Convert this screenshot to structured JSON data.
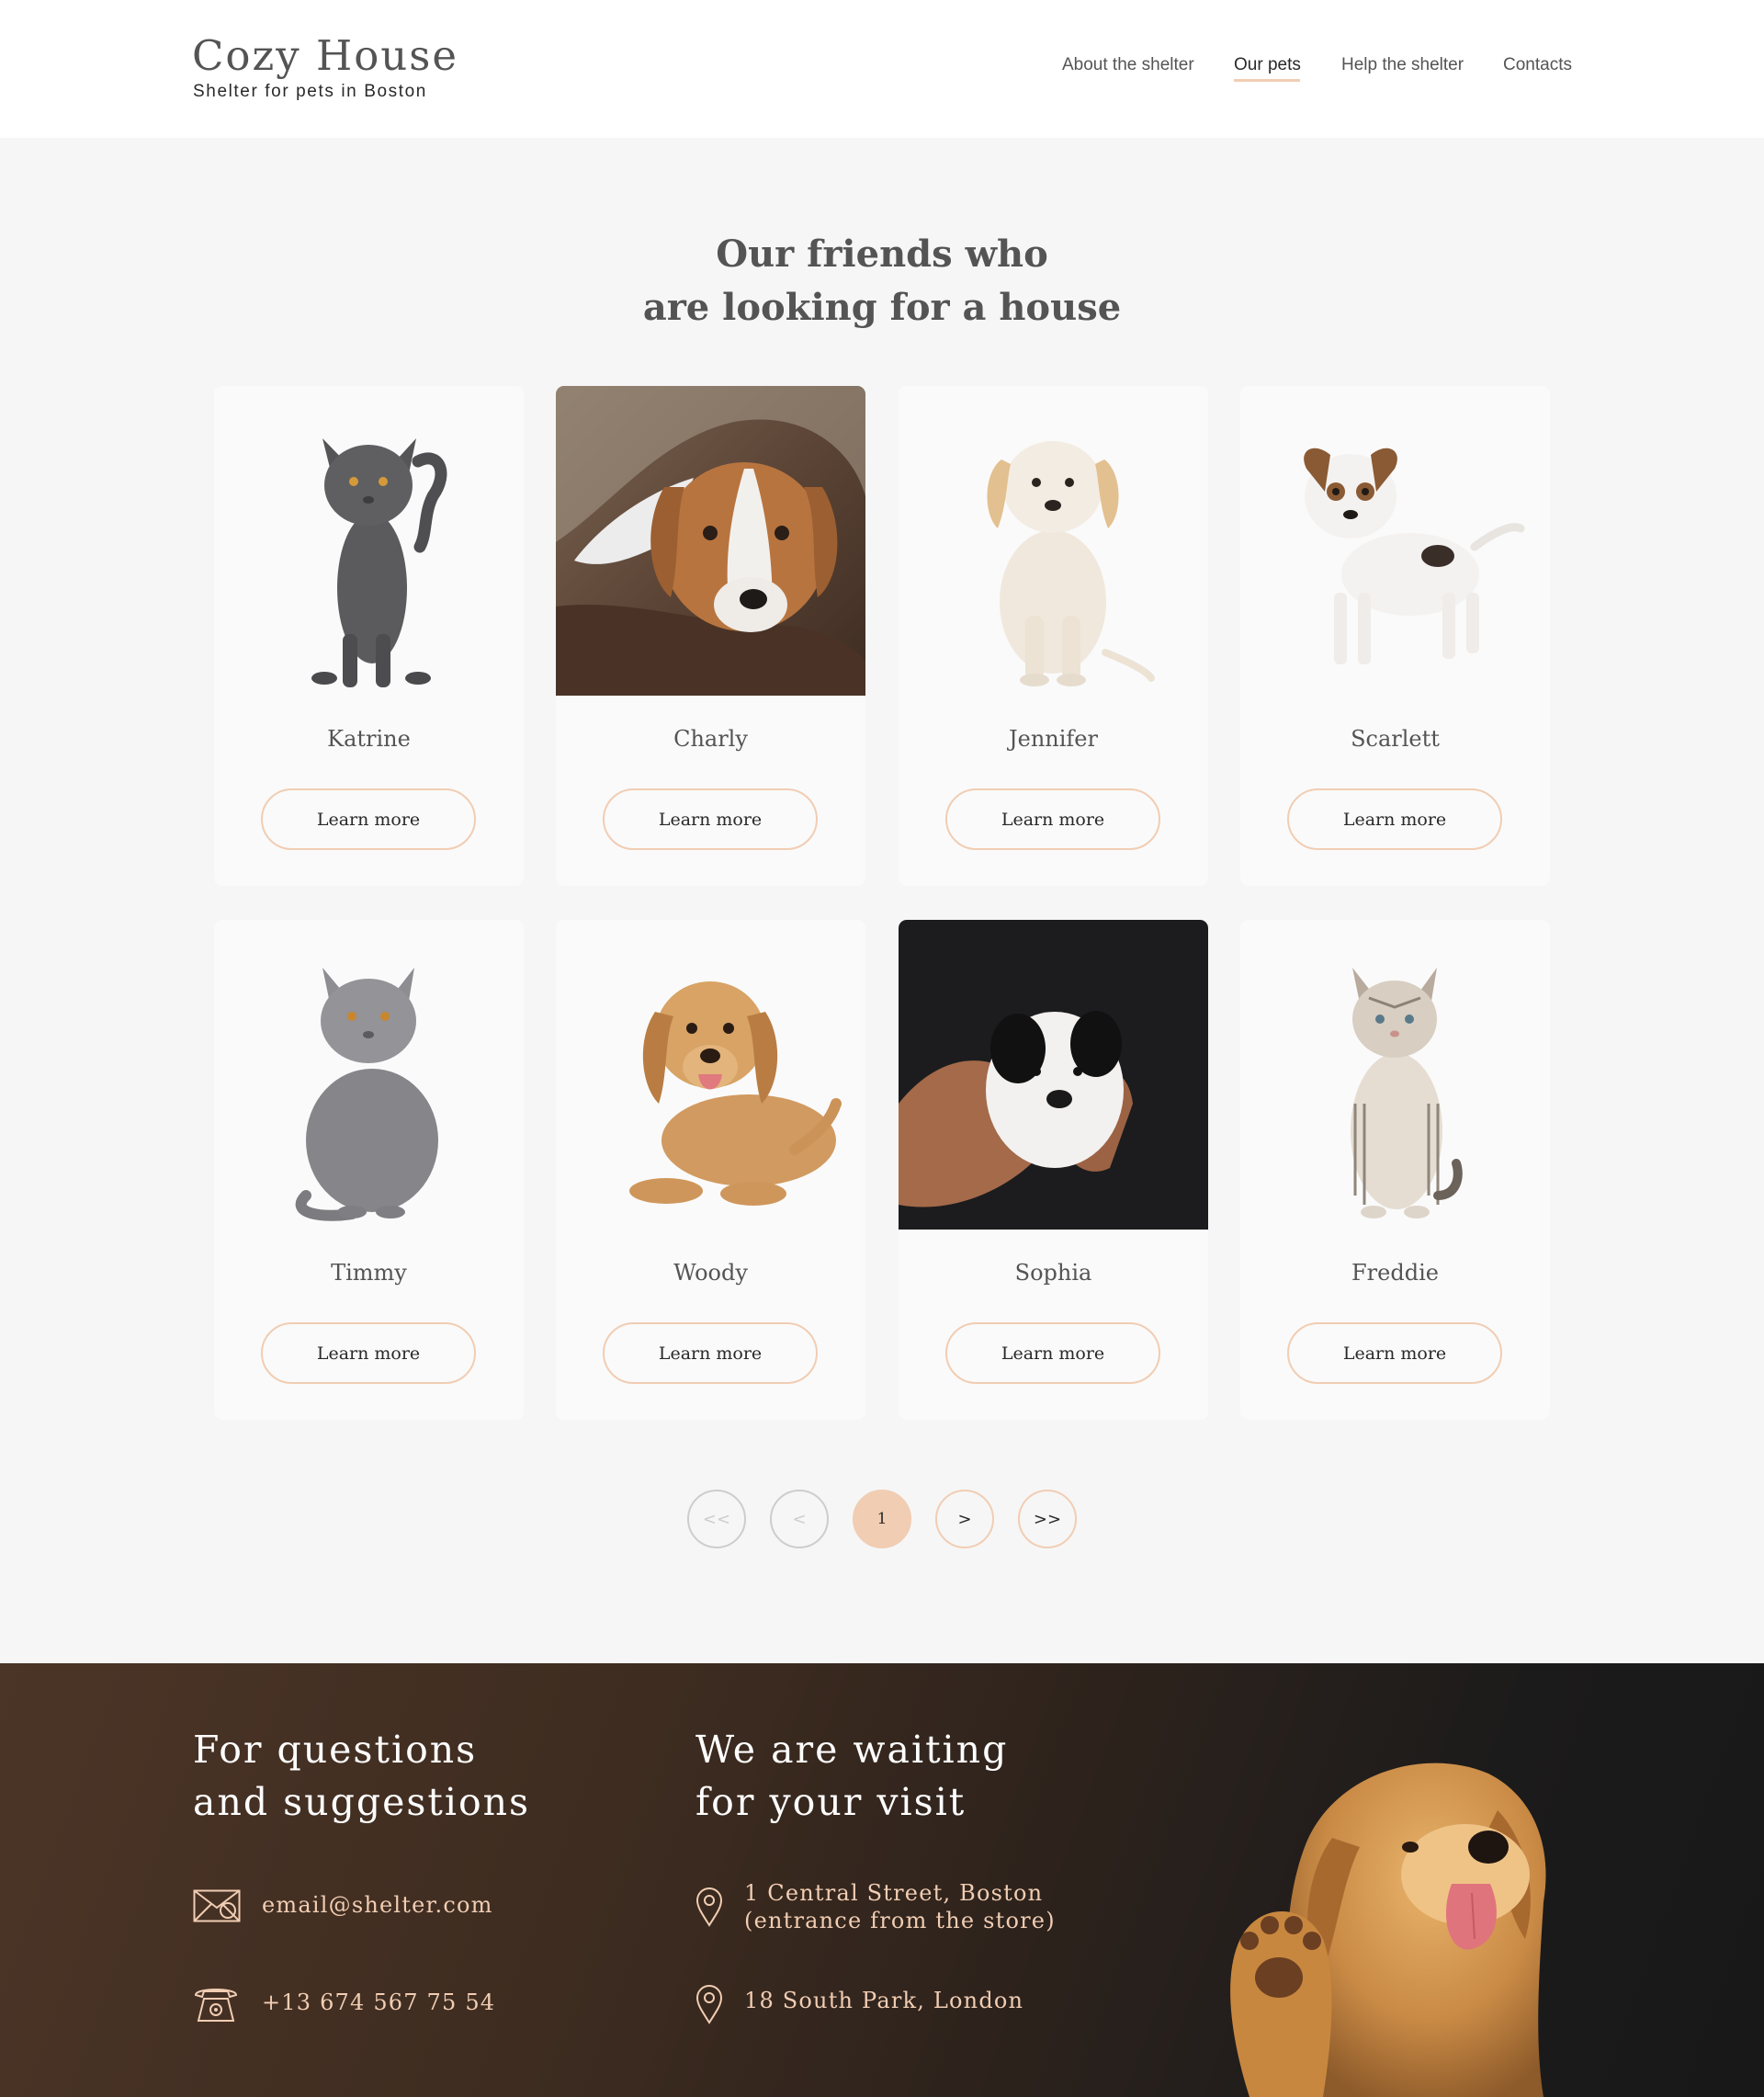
{
  "header": {
    "logo_title": "Cozy House",
    "logo_subtitle": "Shelter for pets in Boston",
    "nav": [
      "About the shelter",
      "Our pets",
      "Help the shelter",
      "Contacts"
    ],
    "active_nav": "Our pets"
  },
  "main": {
    "title_line1": "Our friends who",
    "title_line2": "are looking for a house",
    "pets": [
      {
        "name": "Katrine",
        "button": "Learn more",
        "image": "grey cat standing"
      },
      {
        "name": "Charly",
        "button": "Learn more",
        "image": "dog lying on sofa photo"
      },
      {
        "name": "Jennifer",
        "button": "Learn more",
        "image": "cream puppy sitting"
      },
      {
        "name": "Scarlett",
        "button": "Learn more",
        "image": "jack russell puppy"
      },
      {
        "name": "Timmy",
        "button": "Learn more",
        "image": "grey cat sitting"
      },
      {
        "name": "Woody",
        "button": "Learn more",
        "image": "golden retriever lying"
      },
      {
        "name": "Sophia",
        "button": "Learn more",
        "image": "white puppy in hands photo"
      },
      {
        "name": "Freddie",
        "button": "Learn more",
        "image": "tabby kitten sitting"
      }
    ]
  },
  "pagination": {
    "first": "<<",
    "prev": "<",
    "current": "1",
    "next": ">",
    "last": ">>"
  },
  "footer": {
    "contact_title_line1": "For questions",
    "contact_title_line2": "and suggestions",
    "email": "email@shelter.com",
    "phone": "+13 674 567 75 54",
    "visit_title_line1": "We are waiting",
    "visit_title_line2": "for your visit",
    "address1_line1": "1 Central Street, Boston",
    "address1_line2": "(entrance from the store)",
    "address2": "18 South Park, London",
    "image": "golden puppy waving paw"
  },
  "colors": {
    "accent": "#f1cdb3",
    "text_dark": "#292929",
    "text_gray": "#545454",
    "background": "#f6f6f6",
    "card": "#fafafa"
  },
  "icons": [
    "mail-icon",
    "phone-icon",
    "location-pin-icon"
  ]
}
